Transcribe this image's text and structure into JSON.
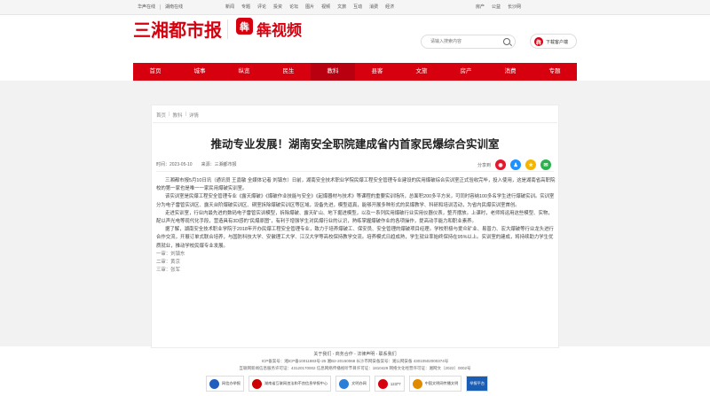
{
  "topbar": {
    "left": [
      "华声在线",
      "湖南在线"
    ],
    "mid": [
      "新闻",
      "专题",
      "评论",
      "投资",
      "论坛",
      "图片",
      "视频",
      "文旅",
      "互动",
      "消费",
      "经济"
    ],
    "right": [
      "房产",
      "公益",
      "长沙网"
    ]
  },
  "header": {
    "logo_main": "三湘都市报",
    "logo_badge": "犇",
    "logo_video": "犇视频",
    "search_placeholder": "请输入搜索内容",
    "download_label": "下载客户端"
  },
  "nav": [
    {
      "label": "首页",
      "active": false
    },
    {
      "label": "城事",
      "active": false
    },
    {
      "label": "纵览",
      "active": false
    },
    {
      "label": "民生",
      "active": false
    },
    {
      "label": "教科",
      "active": true
    },
    {
      "label": "县客",
      "active": false
    },
    {
      "label": "文旅",
      "active": false
    },
    {
      "label": "房产",
      "active": false
    },
    {
      "label": "消费",
      "active": false
    },
    {
      "label": "专题",
      "active": false
    }
  ],
  "breadcrumb": [
    "首页",
    "教科",
    "详情"
  ],
  "article": {
    "title": "推动专业发展！湖南安全职院建成省内首家民爆综合实训室",
    "time": "时间：2023-05-10",
    "source": "来源：三湘都市报",
    "share_label": "分享到",
    "paragraphs": [
      "三湘都市报5月10日讯（通讯员 王嘉敏 全媒体记者 刘镇东）日前，湖南安全技术职业学院民爆工程安全管理专业建设的民用爆破综合实训室正式验收完毕，投入使用，这是湖南省高职院校的第一家也是唯一一家民用爆破实训室。",
      "该实训室是民爆工程安全管理专业《露天爆破》《爆破作业技能与安全》《起爆器材与技术》等课程的重要实训场所，总面积200多平方米，可同时容纳100多名学生进行爆破实训。实训室分为电子雷管实训区、露天台阶爆破实训区、硐室拆除爆破实训区等区域，设备先进，模型逼真，能够开展多种形式的民爆教学、科研和培训活动，为省内民爆实训室首创。",
      "走进实训室，行业内最先进的数码电子雷管实训模型，拆除爆破、露天矿山、地下掘进模型，以及一系列民用爆破行业实用仪器仪表，整齐摆放。上课时，老师将运用这些模型、实物，配以声光电等现代化手段，营造具有3D感的“民爆原图”，有利于增强学生对民爆行业的认识，熟练掌握爆破作业的各项操作，提高动手能力和职业素养。",
      "据了解，湖南安全技术职业学院于2018年开办民爆工程安全管理专业，致力于培养爆破工、保安员、安全管理的爆破项目经理。学校积极与爱众矿业、易普力、宏大爆破等行业龙头进行合作交流，开展订单式联合培养，与国防科技大学、安徽理工大学、江汉大学等高校保持教学交流。培养模式日趋成熟，学生就业率始终保持在95%以上。实训室的建成，将持续助力学生优质就业，推动学校民爆专业发展。"
    ],
    "editors": [
      "一审：刘镇东",
      "二审：黄京",
      "三审：张军"
    ]
  },
  "footer": {
    "links": "关于我们 - 商务合作 - 法律声明 - 联系我们",
    "license1": "ICP备案号：湘ICP备10011883号-25 湘B2-20150068 长沙市网安备案号：湘公网安备 43010502000374号",
    "license2": "互联网新闻信息服务许可证：43120170002 信息网络传播视听节目许可证：1810429 网络文化经营许可证：湘网文〔2022〕0002号",
    "badges": [
      "网信办举报",
      "湖南省互联网违法和不良信息举报中心",
      "文明办网",
      "12377",
      "中国文明网传播文明",
      "举报平台"
    ]
  }
}
